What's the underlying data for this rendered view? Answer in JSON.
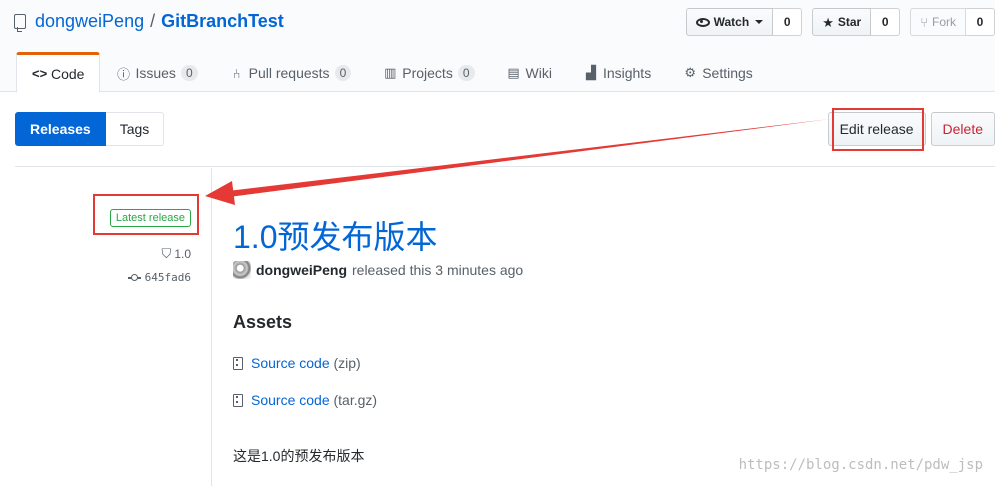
{
  "repo": {
    "owner": "dongweiPeng",
    "separator": "/",
    "name": "GitBranchTest"
  },
  "actions": {
    "watch_label": "Watch",
    "watch_count": "0",
    "star_label": "Star",
    "star_count": "0",
    "fork_label": "Fork",
    "fork_count": "0"
  },
  "tabs": [
    {
      "label": "Code",
      "icon": "code-icon",
      "selected": true
    },
    {
      "label": "Issues",
      "count": "0",
      "icon": "issue-icon"
    },
    {
      "label": "Pull requests",
      "count": "0",
      "icon": "pull-request-icon"
    },
    {
      "label": "Projects",
      "count": "0",
      "icon": "project-icon"
    },
    {
      "label": "Wiki",
      "icon": "book-icon"
    },
    {
      "label": "Insights",
      "icon": "graph-icon"
    },
    {
      "label": "Settings",
      "icon": "gear-icon"
    }
  ],
  "subnav": {
    "releases": "Releases",
    "tags": "Tags"
  },
  "release_actions": {
    "edit": "Edit release",
    "delete": "Delete"
  },
  "release": {
    "latest_label": "Latest release",
    "tag": "1.0",
    "commit": "645fad6",
    "title": "1.0预发布版本",
    "author": "dongweiPeng",
    "released_text": "released this 3 minutes ago",
    "assets_heading": "Assets",
    "assets": [
      {
        "name": "Source code",
        "ext": "(zip)"
      },
      {
        "name": "Source code",
        "ext": "(tar.gz)"
      }
    ],
    "description": "这是1.0的预发布版本"
  },
  "annotation": {
    "color": "#e53935"
  },
  "watermark": "https://blog.csdn.net/pdw_jsp",
  "colors": {
    "link": "#0366d6",
    "accent_tab": "#e36209",
    "success": "#28a745",
    "danger": "#cb2431"
  }
}
